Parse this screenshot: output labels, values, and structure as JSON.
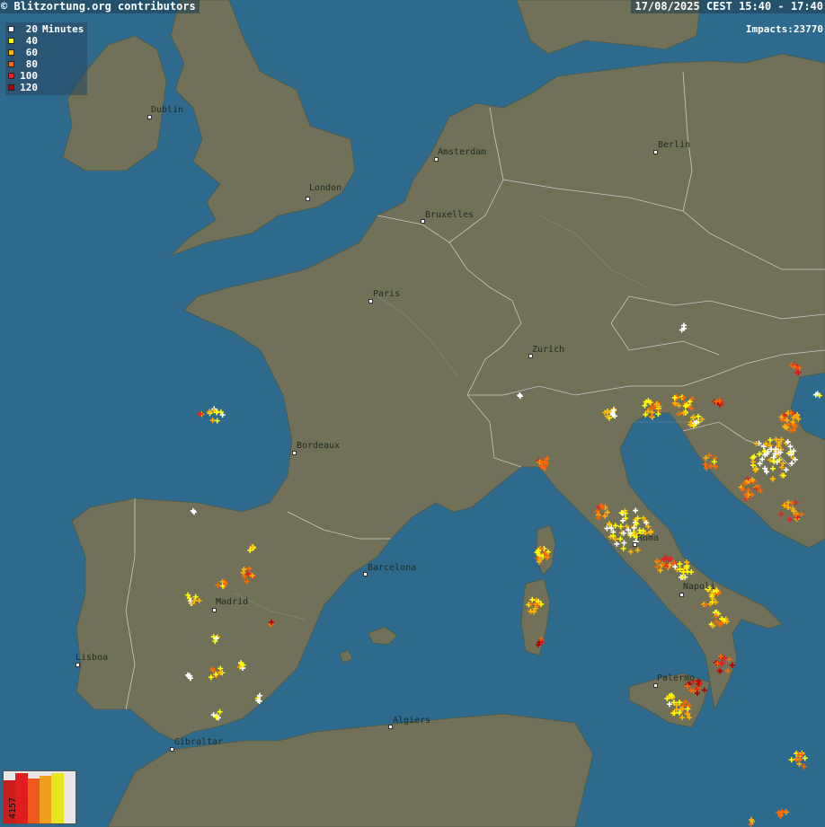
{
  "header": {
    "credit": "© Blitzortung.org contributors",
    "timeframe": "17/08/2025 CEST 15:40 - 17:40"
  },
  "impacts": {
    "label": "Impacts:",
    "value": "23770"
  },
  "legend": {
    "unit": "Minutes",
    "items": [
      {
        "label": "20",
        "color": "#ffffff"
      },
      {
        "label": "40",
        "color": "#ffff00"
      },
      {
        "label": "60",
        "color": "#ffb400"
      },
      {
        "label": "80",
        "color": "#ff6a00"
      },
      {
        "label": "100",
        "color": "#ee1c1c"
      },
      {
        "label": "120",
        "color": "#b40000"
      }
    ]
  },
  "cities": [
    {
      "name": "Dublin"
    },
    {
      "name": "London"
    },
    {
      "name": "Amsterdam"
    },
    {
      "name": "Berlin"
    },
    {
      "name": "Bruxelles"
    },
    {
      "name": "Paris"
    },
    {
      "name": "Zurich"
    },
    {
      "name": "Bordeaux"
    },
    {
      "name": "Barcelona"
    },
    {
      "name": "Madrid"
    },
    {
      "name": "Lisboa"
    },
    {
      "name": "Gibraltar"
    },
    {
      "name": "Algiers"
    },
    {
      "name": "Roma"
    },
    {
      "name": "Napoli"
    },
    {
      "name": "Palermo"
    }
  ],
  "stats": {
    "value": "4157",
    "bar_levels": [
      0.85,
      1.0,
      0.9,
      0.95,
      1.0,
      0.97
    ],
    "bar_colors": [
      "#c81e1e",
      "#e01e1e",
      "#ee5a1e",
      "#f0a01e",
      "#e6e61e",
      "#e8e8e8"
    ]
  },
  "colors": {
    "sea": "#2e6a8e",
    "land": "#707158",
    "border": "#c8c8c8"
  }
}
